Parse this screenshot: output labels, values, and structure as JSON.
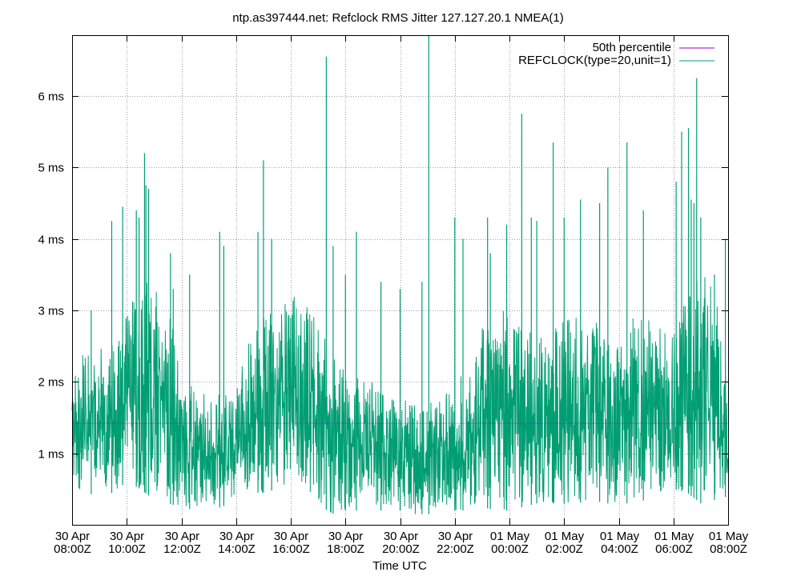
{
  "chart_data": {
    "type": "line",
    "title": "ntp.as397444.net: Refclock RMS Jitter 127.127.20.1 NMEA(1)",
    "xlabel": "Time UTC",
    "ylabel": "",
    "y_unit": "ms",
    "ylim": [
      0.0,
      6.85
    ],
    "y_ticks": [
      1,
      2,
      3,
      4,
      5,
      6
    ],
    "y_tick_labels": [
      "1 ms",
      "2 ms",
      "3 ms",
      "4 ms",
      "5 ms",
      "6 ms"
    ],
    "x_range": [
      "30 Apr 08:00Z",
      "01 May 08:00Z"
    ],
    "x_ticks": [
      {
        "line1": "30 Apr",
        "line2": "08:00Z"
      },
      {
        "line1": "30 Apr",
        "line2": "10:00Z"
      },
      {
        "line1": "30 Apr",
        "line2": "12:00Z"
      },
      {
        "line1": "30 Apr",
        "line2": "14:00Z"
      },
      {
        "line1": "30 Apr",
        "line2": "16:00Z"
      },
      {
        "line1": "30 Apr",
        "line2": "18:00Z"
      },
      {
        "line1": "30 Apr",
        "line2": "20:00Z"
      },
      {
        "line1": "30 Apr",
        "line2": "22:00Z"
      },
      {
        "line1": "01 May",
        "line2": "00:00Z"
      },
      {
        "line1": "01 May",
        "line2": "02:00Z"
      },
      {
        "line1": "01 May",
        "line2": "04:00Z"
      },
      {
        "line1": "01 May",
        "line2": "06:00Z"
      },
      {
        "line1": "01 May",
        "line2": "08:00Z"
      }
    ],
    "grid": true,
    "legend_position": "top-right",
    "series": [
      {
        "name": "50th percentile",
        "color": "#9400d3",
        "kind": "hline",
        "value": 1.42
      },
      {
        "name": "REFCLOCK(type=20,unit=1)",
        "color": "#009e73",
        "kind": "jitter",
        "x_hours": [
          0,
          0.5,
          1,
          1.5,
          2,
          2.5,
          3,
          3.5,
          4,
          4.5,
          5,
          5.5,
          6,
          6.5,
          7,
          7.5,
          8,
          8.5,
          9,
          9.5,
          10,
          10.5,
          11,
          11.5,
          12,
          12.5,
          13,
          13.5,
          14,
          14.5,
          15,
          15.5,
          16,
          16.5,
          17,
          17.5,
          18,
          18.5,
          19,
          19.5,
          20,
          20.5,
          21,
          21.5,
          22,
          22.5,
          23,
          23.5,
          24
        ],
        "band_low": [
          0.5,
          0.45,
          0.4,
          0.45,
          0.6,
          0.5,
          0.35,
          0.3,
          0.25,
          0.2,
          0.2,
          0.25,
          0.4,
          0.45,
          0.45,
          0.5,
          0.6,
          0.5,
          0.3,
          0.15,
          0.2,
          0.2,
          0.2,
          0.2,
          0.2,
          0.15,
          0.15,
          0.15,
          0.2,
          0.2,
          0.25,
          0.2,
          0.2,
          0.25,
          0.3,
          0.3,
          0.3,
          0.3,
          0.35,
          0.3,
          0.3,
          0.3,
          0.35,
          0.4,
          0.5,
          0.45,
          0.3,
          0.35,
          0.4
        ],
        "band_high": [
          2.3,
          2.4,
          2.5,
          2.6,
          3.0,
          3.5,
          3.4,
          3.2,
          2.2,
          1.9,
          1.8,
          1.9,
          2.0,
          2.6,
          2.9,
          3.0,
          3.2,
          3.2,
          2.8,
          2.4,
          2.2,
          2.1,
          2.0,
          1.8,
          1.8,
          1.8,
          1.7,
          1.8,
          1.9,
          2.3,
          2.8,
          3.0,
          3.0,
          2.8,
          2.6,
          2.7,
          2.9,
          3.0,
          3.0,
          2.6,
          2.6,
          2.9,
          2.9,
          2.8,
          3.0,
          3.4,
          3.6,
          3.3,
          2.6
        ],
        "spikes": [
          {
            "x": 0.7,
            "y": 3.0
          },
          {
            "x": 1.45,
            "y": 4.25
          },
          {
            "x": 1.85,
            "y": 4.45
          },
          {
            "x": 2.35,
            "y": 4.4
          },
          {
            "x": 2.45,
            "y": 4.3
          },
          {
            "x": 2.7,
            "y": 4.75
          },
          {
            "x": 2.8,
            "y": 4.7
          },
          {
            "x": 2.65,
            "y": 5.2
          },
          {
            "x": 3.6,
            "y": 3.8
          },
          {
            "x": 3.7,
            "y": 3.3
          },
          {
            "x": 4.3,
            "y": 3.5
          },
          {
            "x": 5.4,
            "y": 4.1
          },
          {
            "x": 5.55,
            "y": 3.9
          },
          {
            "x": 6.8,
            "y": 4.1
          },
          {
            "x": 7.0,
            "y": 5.1
          },
          {
            "x": 7.3,
            "y": 4.0
          },
          {
            "x": 9.3,
            "y": 6.55
          },
          {
            "x": 9.55,
            "y": 3.9
          },
          {
            "x": 10.0,
            "y": 3.5
          },
          {
            "x": 10.4,
            "y": 4.1
          },
          {
            "x": 11.3,
            "y": 3.4
          },
          {
            "x": 12.0,
            "y": 3.3
          },
          {
            "x": 12.8,
            "y": 3.4
          },
          {
            "x": 13.05,
            "y": 6.85
          },
          {
            "x": 14.0,
            "y": 4.3
          },
          {
            "x": 14.3,
            "y": 4.0
          },
          {
            "x": 15.2,
            "y": 4.3
          },
          {
            "x": 15.3,
            "y": 3.8
          },
          {
            "x": 15.9,
            "y": 4.2
          },
          {
            "x": 16.45,
            "y": 5.75
          },
          {
            "x": 16.8,
            "y": 4.3
          },
          {
            "x": 17.0,
            "y": 4.25
          },
          {
            "x": 17.6,
            "y": 5.35
          },
          {
            "x": 18.0,
            "y": 4.3
          },
          {
            "x": 18.6,
            "y": 4.55
          },
          {
            "x": 19.3,
            "y": 4.5
          },
          {
            "x": 19.6,
            "y": 5.0
          },
          {
            "x": 20.3,
            "y": 5.35
          },
          {
            "x": 20.9,
            "y": 4.4
          },
          {
            "x": 22.1,
            "y": 4.8
          },
          {
            "x": 22.3,
            "y": 5.5
          },
          {
            "x": 22.55,
            "y": 5.55
          },
          {
            "x": 22.65,
            "y": 4.55
          },
          {
            "x": 22.75,
            "y": 4.5
          },
          {
            "x": 22.85,
            "y": 6.25
          },
          {
            "x": 23.0,
            "y": 4.3
          },
          {
            "x": 23.5,
            "y": 3.5
          },
          {
            "x": 23.9,
            "y": 4.0
          }
        ]
      }
    ]
  }
}
